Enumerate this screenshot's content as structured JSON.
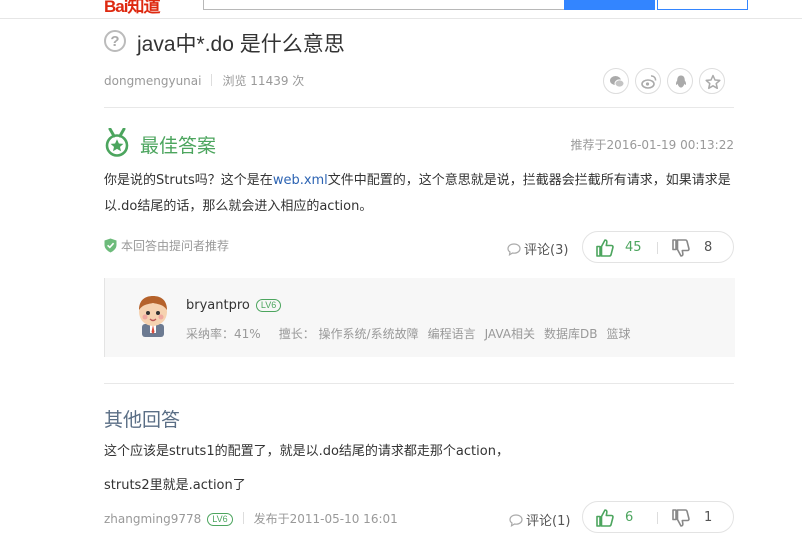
{
  "header": {
    "logo_text": "Bai知道",
    "search_value": "",
    "colors": {
      "logo": "#de2910",
      "search_button": "#3385ff"
    }
  },
  "question": {
    "icon": "question-circle-icon",
    "title": "java中*.do 是什么意思",
    "author": "dongmengyunai",
    "views": "浏览 11439 次",
    "share_icons": [
      "wechat-icon",
      "weibo-icon",
      "qq-icon",
      "star-icon"
    ]
  },
  "best_answer": {
    "icon": "medal-icon",
    "title": "最佳答案",
    "recommended_time": "推荐于2016-01-19 00:13:22",
    "text_before": "你是说的Struts吗？这个是在",
    "link_text": "web.xml",
    "text_after": "文件中配置的，这个意思就是说，拦截器会拦截所有请求，如果请求是以.do结尾的话，那么就会进入相应的action。",
    "recommend_note": "本回答由提问者推荐",
    "comments": "评论(3)",
    "upvotes": "45",
    "downvotes": "8",
    "accent_color": "#4ca55e"
  },
  "answerer": {
    "name": "bryantpro",
    "level": "LV6",
    "adoption": "采纳率：41%",
    "skills_label": "擅长：",
    "skills": [
      "操作系统/系统故障",
      "编程语言",
      "JAVA相关",
      "数据库DB",
      "篮球"
    ]
  },
  "other_answers": {
    "title": "其他回答",
    "items": [
      {
        "line1": "这个应该是struts1的配置了，就是以.do结尾的请求都走那个action，",
        "line2": "struts2里就是.action了",
        "author": "zhangming9778",
        "level": "LV6",
        "published": "发布于2011-05-10 16:01",
        "comments": "评论(1)",
        "upvotes": "6",
        "downvotes": "1"
      }
    ]
  }
}
